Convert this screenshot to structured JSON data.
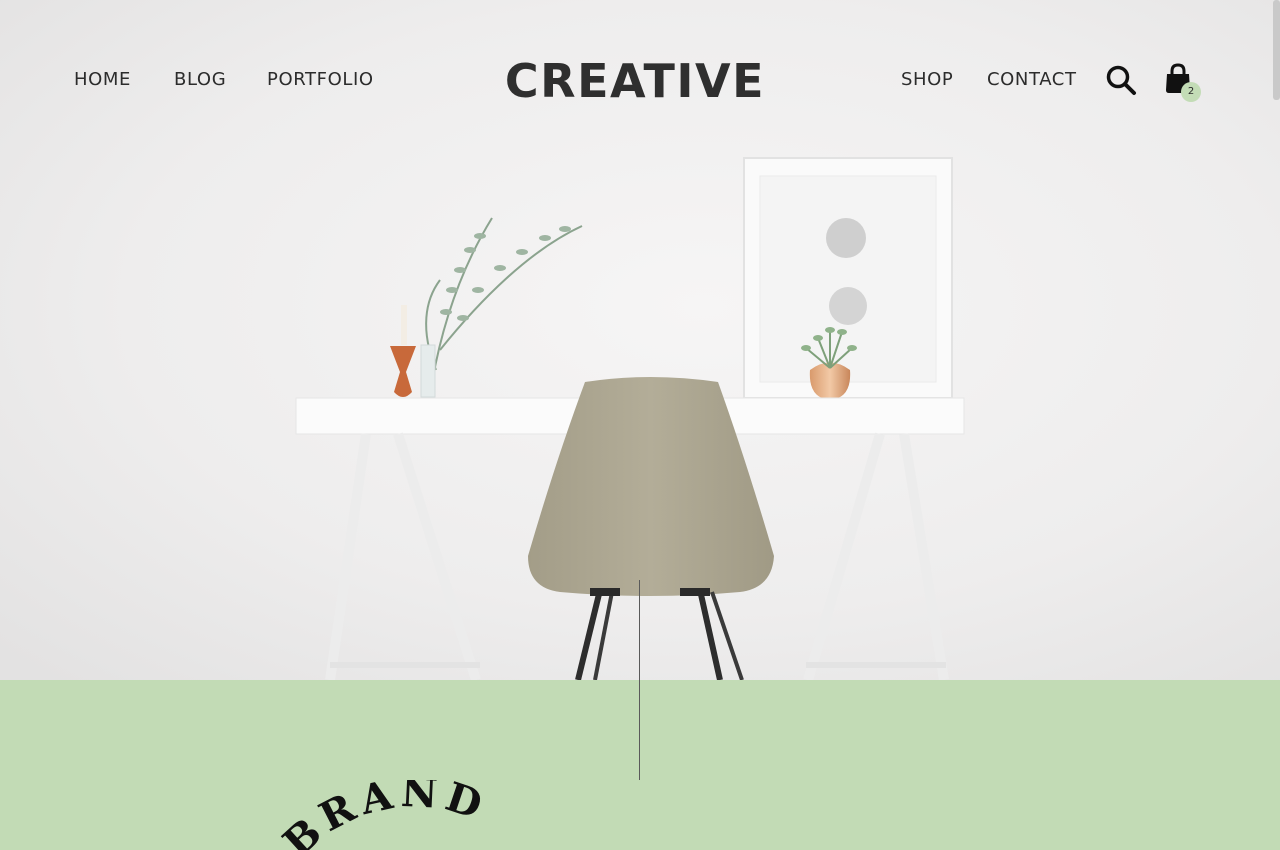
{
  "nav": {
    "left_links": [
      {
        "label": "HOME"
      },
      {
        "label": "BLOG"
      },
      {
        "label": "PORTFOLIO"
      }
    ],
    "logo": "CREATIVE",
    "right_links": [
      {
        "label": "SHOP"
      },
      {
        "label": "CONTACT"
      }
    ],
    "search_icon": "search-icon",
    "cart_icon": "shopping-bag-icon",
    "cart_count": "2"
  },
  "brand": {
    "curved_text": "BRAND"
  },
  "colors": {
    "accent_green": "#c2dbb5",
    "badge_green": "#c3dcb6",
    "chair": "#aea893",
    "text_dark": "#2c2c2c"
  }
}
